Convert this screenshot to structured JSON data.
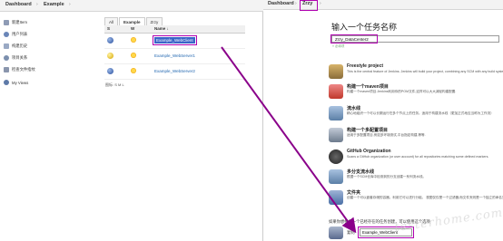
{
  "left": {
    "breadcrumb": [
      "Dashboard",
      "Example"
    ],
    "sidebar": [
      {
        "label": "新建Item",
        "icon": "new-item-icon"
      },
      {
        "label": "用户列表",
        "icon": "users-icon"
      },
      {
        "label": "构建历史",
        "icon": "build-history-icon"
      },
      {
        "label": "项目关系",
        "icon": "project-relationship-icon"
      },
      {
        "label": "检查文件指纹",
        "icon": "fingerprint-icon"
      },
      {
        "label": "My Views",
        "icon": "my-views-icon"
      }
    ],
    "tabs": [
      "All",
      "Example",
      "Zrzy"
    ],
    "active_tab": "Example",
    "table": {
      "headers": [
        "S",
        "W",
        "Name ↓"
      ],
      "rows": [
        {
          "status": "blue",
          "name": "Example_WebClient"
        },
        {
          "status": "yellow",
          "name": "Example_WebServer1"
        },
        {
          "status": "blue",
          "name": "Example_WebServer2"
        }
      ]
    },
    "icon_size": "图标: S M L"
  },
  "right": {
    "breadcrumb": [
      "Dashboard",
      "Zrzy"
    ],
    "title": "输入一个任务名称",
    "name_value": "Zrzy_DataCenter2",
    "required_note": "» 必填项",
    "types": [
      {
        "name": "Freestyle project",
        "desc": "This is the central feature of Jenkins. Jenkins will build your project, combining any SCM with any build system",
        "icon": "freestyle-project-icon",
        "color": "#8a6d3b"
      },
      {
        "name": "构建一个maven项目",
        "desc": "构建一个maven项目.Jenkins利用你的POM文件,这样可以大大减轻构建配置.",
        "icon": "maven-project-icon",
        "color": "#c0392b"
      },
      {
        "name": "流水线",
        "desc": "精心地组织一个可以长期运行在多个节点上的任务。适用于构建流水线（更加正式地应当称为工作流）",
        "icon": "pipeline-icon",
        "color": "#5b7fa6"
      },
      {
        "name": "构建一个多配置项目",
        "desc": "适用于多配置项目,例如多环境测试,平台指定构建,等等.",
        "icon": "multi-config-project-icon",
        "color": "#6d7b8d"
      },
      {
        "name": "GitHub Organization",
        "desc": "Scans a GitHub organization (or user account) for all repositories matching some defined markers.",
        "icon": "github-organization-icon",
        "color": "#333333"
      },
      {
        "name": "多分支流水线",
        "desc": "根据一个SCM仓库中检测到的分支创建一系列流水线。",
        "icon": "multibranch-pipeline-icon",
        "color": "#5b7fa6"
      },
      {
        "name": "文件夹",
        "desc": "创建一个可以嵌套存储的容器。利用它可以进行分组。 视图仅仅是一个过滤器,而文件夹则是一个独立的命名空间。",
        "icon": "folder-icon",
        "color": "#4a6fa5"
      }
    ],
    "copy_hint": "如果你想根据一个已经存在的任务创建，可以使用这个选项",
    "copy_label": "复制",
    "copy_value": "Example_WebClient"
  },
  "watermark": "testerhome.com",
  "colors": {
    "highlight": "#b000b0",
    "link": "#2066b0",
    "selection": "#3a64c8"
  }
}
